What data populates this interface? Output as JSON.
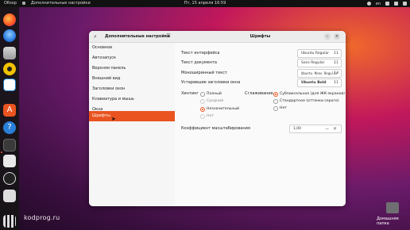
{
  "topbar": {
    "activities": "Обзор",
    "app_name": "Дополнительные настройки",
    "datetime": "Пт, 15 апреля 16:59",
    "language": "en"
  },
  "watermark": "kodprog.ru",
  "desktop_icon": {
    "label": "Домашняя папка"
  },
  "sidebar": {
    "title": "Дополнительные настройки",
    "items": [
      {
        "label": "Основное"
      },
      {
        "label": "Автозапуск"
      },
      {
        "label": "Верхняя панель"
      },
      {
        "label": "Внешний вид"
      },
      {
        "label": "Заголовки окон"
      },
      {
        "label": "Клавиатура и мышь"
      },
      {
        "label": "Окна"
      },
      {
        "label": "Шрифты",
        "active": true
      }
    ]
  },
  "content": {
    "title": "Шрифты",
    "fonts": [
      {
        "label": "Текст интерфейса",
        "font": "Ubuntu Regular",
        "size": "11"
      },
      {
        "label": "Текст документа",
        "font": "Sans Regular",
        "size": "11"
      },
      {
        "label": "Моноширинный текст",
        "font": "Ubuntu Mono Regular",
        "size": "13"
      },
      {
        "label": "Устаревшие заголовки окна",
        "font": "Ubuntu Bold",
        "size": "11"
      }
    ],
    "hinting": {
      "label": "Хинтинг",
      "options": [
        {
          "label": "Полный",
          "checked": false
        },
        {
          "label": "Средний",
          "checked": false
        },
        {
          "label": "Незначительный",
          "checked": true
        },
        {
          "label": "Нет",
          "checked": false
        }
      ]
    },
    "antialiasing": {
      "label": "Сглаживание",
      "options": [
        {
          "label": "Субпиксельное (для ЖК-экранов)",
          "checked": true
        },
        {
          "label": "Стандартное (оттенки серого)",
          "checked": false
        },
        {
          "label": "Нет",
          "checked": false
        }
      ]
    },
    "scale": {
      "label": "Коэффициент масштабирования",
      "value": "1,00",
      "minus": "−",
      "plus": "+"
    }
  },
  "colors": {
    "accent": "#e95420"
  }
}
